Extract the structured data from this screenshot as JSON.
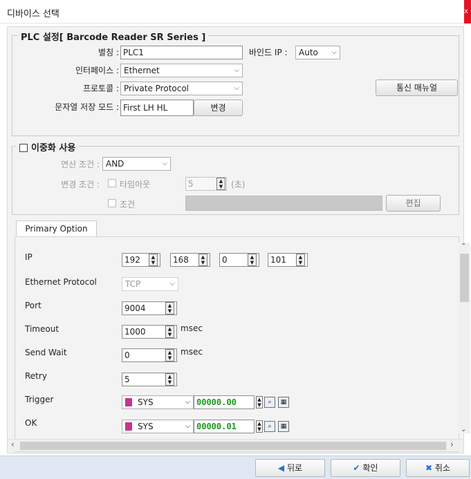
{
  "window": {
    "title": "디바이스 선택",
    "close_glyph": "x"
  },
  "plc": {
    "legend": "PLC 설정[ Barcode Reader SR Series ]",
    "alias_label": "별칭 :",
    "alias_value": "PLC1",
    "interface_label": "인터페이스 :",
    "interface_value": "Ethernet",
    "protocol_label": "프로토콜 :",
    "protocol_value": "Private Protocol",
    "string_mode_label": "문자열 저장 모드 :",
    "string_mode_value": "First LH HL",
    "change_button": "변경",
    "bind_ip_label": "바인드 IP :",
    "bind_ip_value": "Auto",
    "manual_button": "통신 매뉴얼"
  },
  "redundancy": {
    "legend": "이중화 사용",
    "op_condition_label": "연산 조건 :",
    "op_condition_value": "AND",
    "change_condition_label": "변경 조건 :",
    "timeout_check_label": "타임아웃",
    "timeout_value": "5",
    "timeout_unit": "(초)",
    "condition_check_label": "조건",
    "edit_button": "편집"
  },
  "primary": {
    "tab_label": "Primary Option",
    "ip_label": "IP",
    "ip_octets": [
      "192",
      "168",
      "0",
      "101"
    ],
    "eth_protocol_label": "Ethernet Protocol",
    "eth_protocol_value": "TCP",
    "port_label": "Port",
    "port_value": "9004",
    "timeout_label": "Timeout",
    "timeout_value": "1000",
    "timeout_unit": "msec",
    "send_wait_label": "Send Wait",
    "send_wait_value": "0",
    "send_wait_unit": "msec",
    "retry_label": "Retry",
    "retry_value": "5",
    "trigger_label": "Trigger",
    "trigger_device": "SYS",
    "trigger_address": "00000.00",
    "ok_label": "OK",
    "ok_device": "SYS",
    "ok_address": "00000.01"
  },
  "footer": {
    "back_button": "뒤로",
    "ok_button": "확인",
    "cancel_button": "취소"
  },
  "colors": {
    "address_green": "#169a1a",
    "device_mark": "#c6358f",
    "footer_bg": "#dfe8f3"
  }
}
